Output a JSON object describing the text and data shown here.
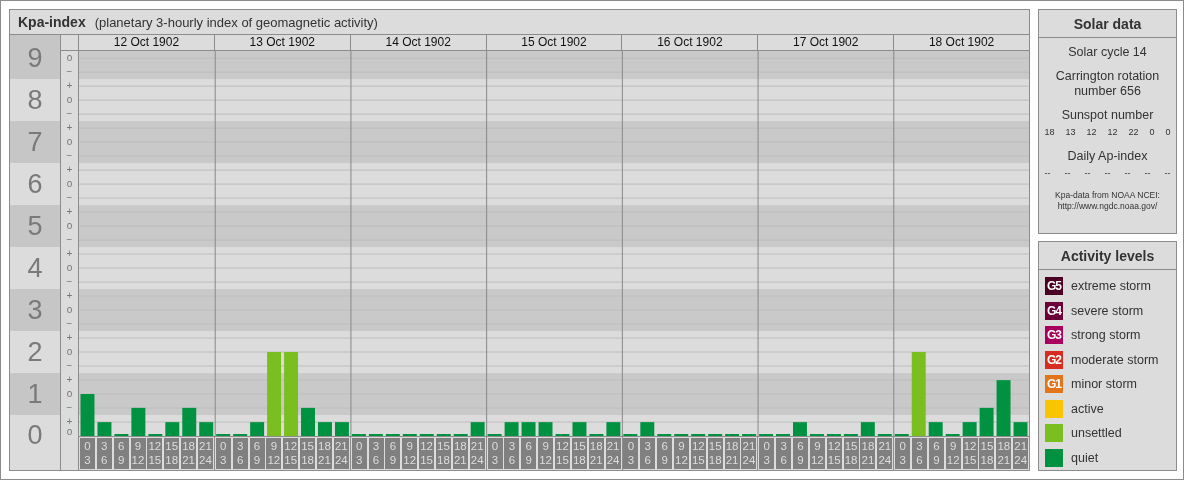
{
  "kp_panel": {
    "title": "Kpa-index",
    "subtitle": "(planetary 3-hourly index of geomagnetic activity)",
    "days": [
      "12 Oct 1902",
      "13 Oct 1902",
      "14 Oct 1902",
      "15 Oct 1902",
      "16 Oct 1902",
      "17 Oct 1902",
      "18 Oct 1902"
    ],
    "scale_marks": [
      "o",
      "−",
      "+",
      "o",
      "−",
      "+",
      "o",
      "−",
      "+",
      "o",
      "−",
      "+",
      "o",
      "−",
      "+",
      "o",
      "−",
      "+",
      "o",
      "−",
      "+",
      "o",
      "−",
      "+",
      "o",
      "−",
      "+",
      "o"
    ],
    "chart_data": {
      "type": "bar",
      "grid": true,
      "ylim": [
        0,
        9.17
      ],
      "yticks": [
        0,
        1,
        2,
        3,
        4,
        5,
        6,
        7,
        8,
        9
      ],
      "bands": [
        {
          "axis": "y",
          "from": 0.5,
          "to": 1.5
        },
        {
          "axis": "y",
          "from": 2.5,
          "to": 3.5
        },
        {
          "axis": "y",
          "from": 4.5,
          "to": 5.5
        },
        {
          "axis": "y",
          "from": 6.5,
          "to": 7.5
        },
        {
          "axis": "y",
          "from": 8.5,
          "to": 9.17
        }
      ],
      "categories": [
        "0 3",
        "3 6",
        "6 9",
        "9 12",
        "12 15",
        "15 18",
        "18 21",
        "21 24",
        "0 3",
        "3 6",
        "6 9",
        "9 12",
        "12 15",
        "15 18",
        "18 21",
        "21 24",
        "0 3",
        "3 6",
        "6 9",
        "9 12",
        "12 15",
        "15 18",
        "18 21",
        "21 24",
        "0 3",
        "3 6",
        "6 9",
        "9 12",
        "12 15",
        "15 18",
        "18 21",
        "21 24",
        "0 3",
        "3 6",
        "6 9",
        "9 12",
        "12 15",
        "15 18",
        "18 21",
        "21 24",
        "0 3",
        "3 6",
        "6 9",
        "9 12",
        "12 15",
        "15 18",
        "18 21",
        "21 24",
        "0 3",
        "3 6",
        "6 9",
        "9 12",
        "12 15",
        "15 18",
        "18 21",
        "21 24"
      ],
      "series": [
        {
          "color": "#009240",
          "values": [
            1.0,
            0.33,
            0,
            0.67,
            0,
            0.33,
            0.67,
            0.33,
            0,
            0,
            0.33,
            null,
            null,
            0.67,
            0.33,
            0.33,
            0,
            0,
            0,
            0,
            0,
            0,
            0,
            0.33,
            0,
            0.33,
            0.33,
            0.33,
            0,
            0.33,
            0,
            0.33,
            0,
            0.33,
            0,
            0,
            0,
            0,
            0,
            0,
            0,
            0,
            0.33,
            0,
            0,
            0,
            0.33,
            0,
            0,
            null,
            0.33,
            0,
            0.33,
            0.67,
            1.33,
            0.33
          ]
        },
        {
          "color": "#7abf1f",
          "values": [
            null,
            null,
            null,
            null,
            null,
            null,
            null,
            null,
            null,
            null,
            null,
            2.0,
            2.0,
            null,
            null,
            null,
            null,
            null,
            null,
            null,
            null,
            null,
            null,
            null,
            null,
            null,
            null,
            null,
            null,
            null,
            null,
            null,
            null,
            null,
            null,
            null,
            null,
            null,
            null,
            null,
            null,
            null,
            null,
            null,
            null,
            null,
            null,
            null,
            null,
            2.0,
            null,
            null,
            null,
            null,
            null,
            null
          ]
        }
      ]
    }
  },
  "solar_data": {
    "title": "Solar data",
    "cycle": "Solar cycle 14",
    "rotation": "Carrington rotation number 656",
    "sunspot_heading": "Sunspot number",
    "sunspots": [
      "18",
      "13",
      "12",
      "12",
      "22",
      "0",
      "0"
    ],
    "ap_heading": "Daily Ap-index",
    "ap_values": [
      "--",
      "--",
      "--",
      "--",
      "--",
      "--",
      "--"
    ],
    "source_note": "Kpa-data from NOAA NCEI:",
    "source_link": "http://www.ngdc.noaa.gov/"
  },
  "activity_levels": {
    "title": "Activity levels",
    "items": [
      {
        "code": "G5",
        "label": "extreme storm",
        "color": "#4c0021"
      },
      {
        "code": "G4",
        "label": "severe storm",
        "color": "#6b0039"
      },
      {
        "code": "G3",
        "label": "strong storm",
        "color": "#a8005c"
      },
      {
        "code": "G2",
        "label": "moderate storm",
        "color": "#d62d20"
      },
      {
        "code": "G1",
        "label": "minor storm",
        "color": "#e2741a"
      },
      {
        "label": "active",
        "color": "#f8c500"
      },
      {
        "label": "unsettled",
        "color": "#7abf1f"
      },
      {
        "label": "quiet",
        "color": "#009240"
      }
    ]
  }
}
